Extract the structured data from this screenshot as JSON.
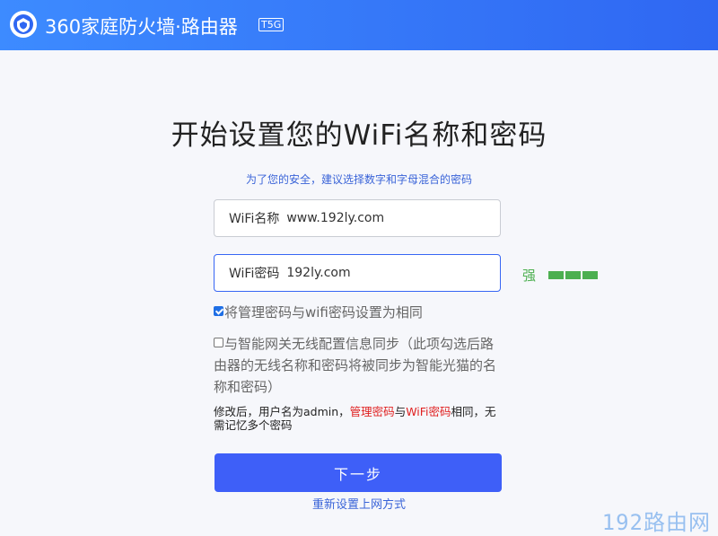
{
  "header": {
    "brand_text": "360家庭防火墙·路由器",
    "model": "T5G",
    "logo_icon": "360-shield-icon"
  },
  "setup": {
    "title": "开始设置您的WiFi名称和密码",
    "hint": "为了您的安全，建议选择数字和字母混合的密码",
    "wifi_name": {
      "label": "WiFi名称",
      "value": "www.192ly.com"
    },
    "wifi_password": {
      "label": "WiFi密码",
      "value": "192ly.com"
    },
    "strength": {
      "label": "强",
      "level": 3,
      "max": 3,
      "color": "#4caf50"
    },
    "same_password_checkbox": {
      "label": "将管理密码与wifi密码设置为相同",
      "checked": true
    },
    "sync_checkbox": {
      "label": "与智能网关无线配置信息同步（此项勾选后路由器的无线名称和密码将被同步为智能光猫的名称和密码）",
      "checked": false
    },
    "note": {
      "prefix": "修改后，用户名为admin，",
      "admin_pw": "管理密码",
      "mid": "与",
      "wifi_pw": "WiFi密码",
      "suffix": "相同，无需记忆多个密码"
    },
    "next_button": "下一步",
    "reset_link": "重新设置上网方式"
  },
  "watermark": "192路由网",
  "colors": {
    "accent": "#3e5ff8",
    "header": "#2f67f2",
    "link": "#3a64d8",
    "warn": "#e02020"
  }
}
